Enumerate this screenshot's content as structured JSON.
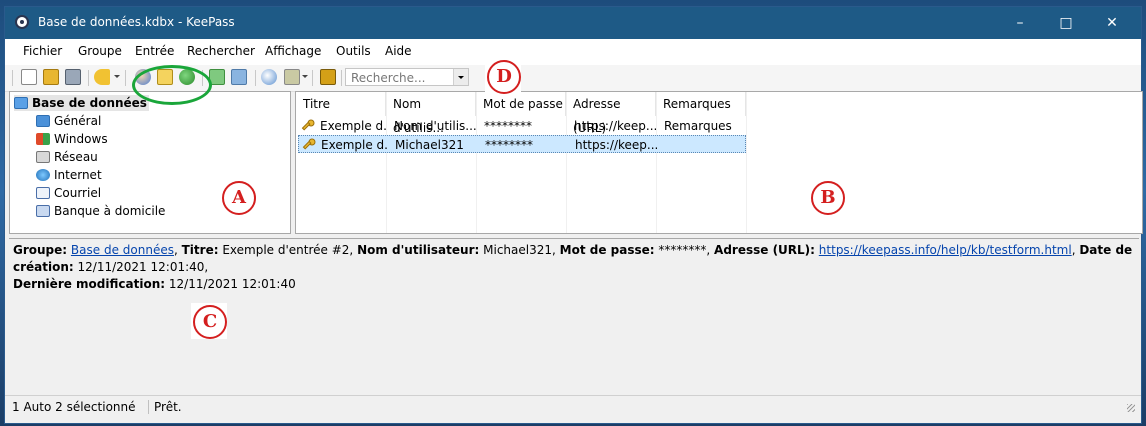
{
  "window": {
    "title": "Base de données.kdbx - KeePass"
  },
  "menu": [
    "Fichier",
    "Groupe",
    "Entrée",
    "Rechercher",
    "Affichage",
    "Outils",
    "Aide"
  ],
  "search": {
    "placeholder": "Recherche..."
  },
  "groups": [
    {
      "label": "Base de données",
      "icon": "folder-open-icon"
    },
    {
      "label": "Général",
      "icon": "folder-icon"
    },
    {
      "label": "Windows",
      "icon": "windows-icon"
    },
    {
      "label": "Réseau",
      "icon": "network-icon"
    },
    {
      "label": "Internet",
      "icon": "globe-icon"
    },
    {
      "label": "Courriel",
      "icon": "email-icon"
    },
    {
      "label": "Banque à domicile",
      "icon": "bank-icon"
    }
  ],
  "columns": [
    "Titre",
    "Nom d'utilis...",
    "Mot de passe",
    "Adresse (URL)",
    "Remarques"
  ],
  "entries": [
    {
      "title": "Exemple d...",
      "user": "Nom d'utilis...",
      "password": "********",
      "url": "https://keep...",
      "notes": "Remarques",
      "selected": false
    },
    {
      "title": "Exemple d...",
      "user": "Michael321",
      "password": "********",
      "url": "https://keep...",
      "notes": "",
      "selected": true
    }
  ],
  "details": {
    "group_label": "Groupe:",
    "group_value": "Base de données",
    "title_label": "Titre:",
    "title_value": "Exemple d'entrée #2",
    "user_label": "Nom d'utilisateur:",
    "user_value": "Michael321",
    "password_label": "Mot de passe:",
    "password_value": "********",
    "url_label": "Adresse (URL):",
    "url_value": "https://keepass.info/help/kb/testform.html",
    "created_label": "Date de création:",
    "created_value": "12/11/2021 12:01:40",
    "modified_label": "Dernière modification:",
    "modified_value": "12/11/2021 12:01:40"
  },
  "status": {
    "selection": "1 Auto 2 sélectionné",
    "state": "Prêt."
  },
  "annotations": {
    "a": "A",
    "b": "B",
    "c": "C",
    "d": "D"
  },
  "colors": {
    "titlebar": "#1e5a86",
    "selection": "#cce8ff",
    "annotation_red": "#d41f1f",
    "annotation_green": "#1aa63a",
    "link": "#0645ad"
  }
}
